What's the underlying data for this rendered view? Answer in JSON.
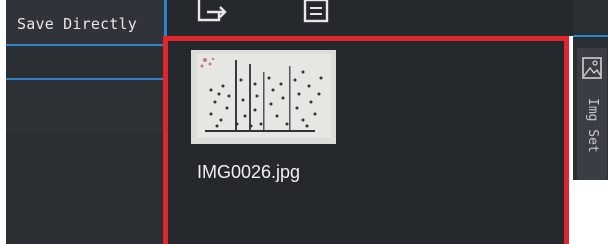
{
  "left_panel": {
    "save_label": "Save Directly"
  },
  "toolbar": {
    "icons": [
      "export-image-icon",
      "clipboard-icon"
    ]
  },
  "gallery": {
    "items": [
      {
        "filename": "IMG0026.jpg"
      }
    ]
  },
  "side_tab": {
    "label": "Img Set",
    "icon": "image-icon"
  },
  "colors": {
    "accent_blue": "#2e84c8",
    "selection_red": "#e0262c",
    "panel_dark": "#25282c"
  }
}
